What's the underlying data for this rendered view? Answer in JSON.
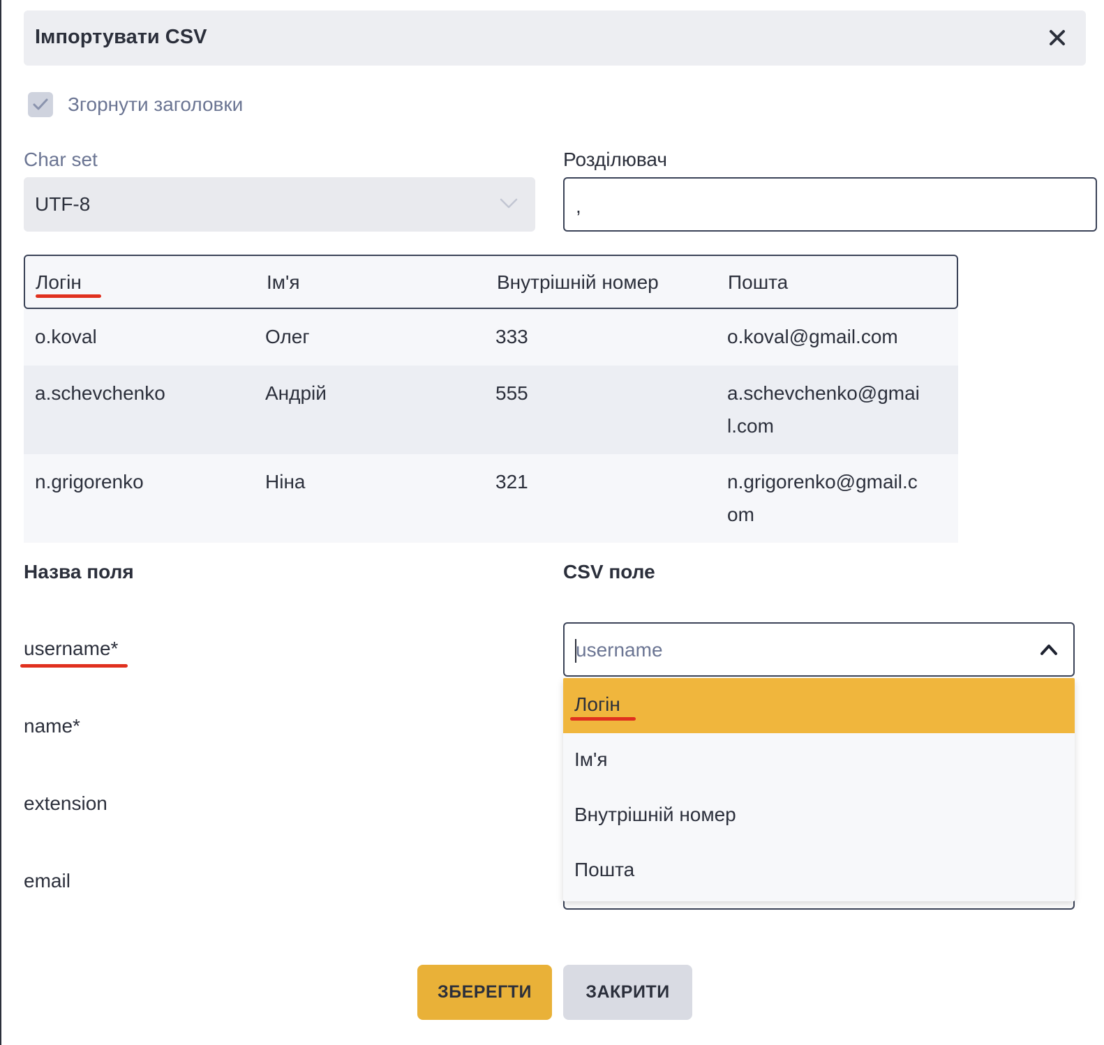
{
  "dialog": {
    "title": "Імпортувати CSV"
  },
  "collapse_headers": {
    "label": "Згорнути заголовки",
    "checked": true
  },
  "charset": {
    "label": "Char set",
    "value": "UTF-8"
  },
  "separator": {
    "label": "Розділювач",
    "value": ","
  },
  "preview": {
    "headers": [
      "Логін",
      "Ім'я",
      "Внутрішній номер",
      "Пошта"
    ],
    "rows": [
      [
        "o.koval",
        "Олег",
        "333",
        "o.koval@gmail.com"
      ],
      [
        "a.schevchenko",
        "Андрій",
        "555",
        "a.schevchenko@gmai",
        "l.com"
      ],
      [
        "n.grigorenko",
        "Ніна",
        "321",
        "n.grigorenko@gmail.c",
        "om"
      ]
    ]
  },
  "mapping": {
    "field_name_title": "Назва поля",
    "csv_field_title": "CSV поле",
    "fields": [
      "username*",
      "name*",
      "extension",
      "email"
    ],
    "csv_select_placeholder": "username",
    "options": [
      "Логін",
      "Ім'я",
      "Внутрішній номер",
      "Пошта"
    ],
    "selected_option": "Логін"
  },
  "buttons": {
    "save": "ЗБЕРЕГТИ",
    "close": "ЗАКРИТИ"
  },
  "colors": {
    "accent": "#f0b63d",
    "underline": "#e0301e",
    "panel": "#edeef2"
  }
}
